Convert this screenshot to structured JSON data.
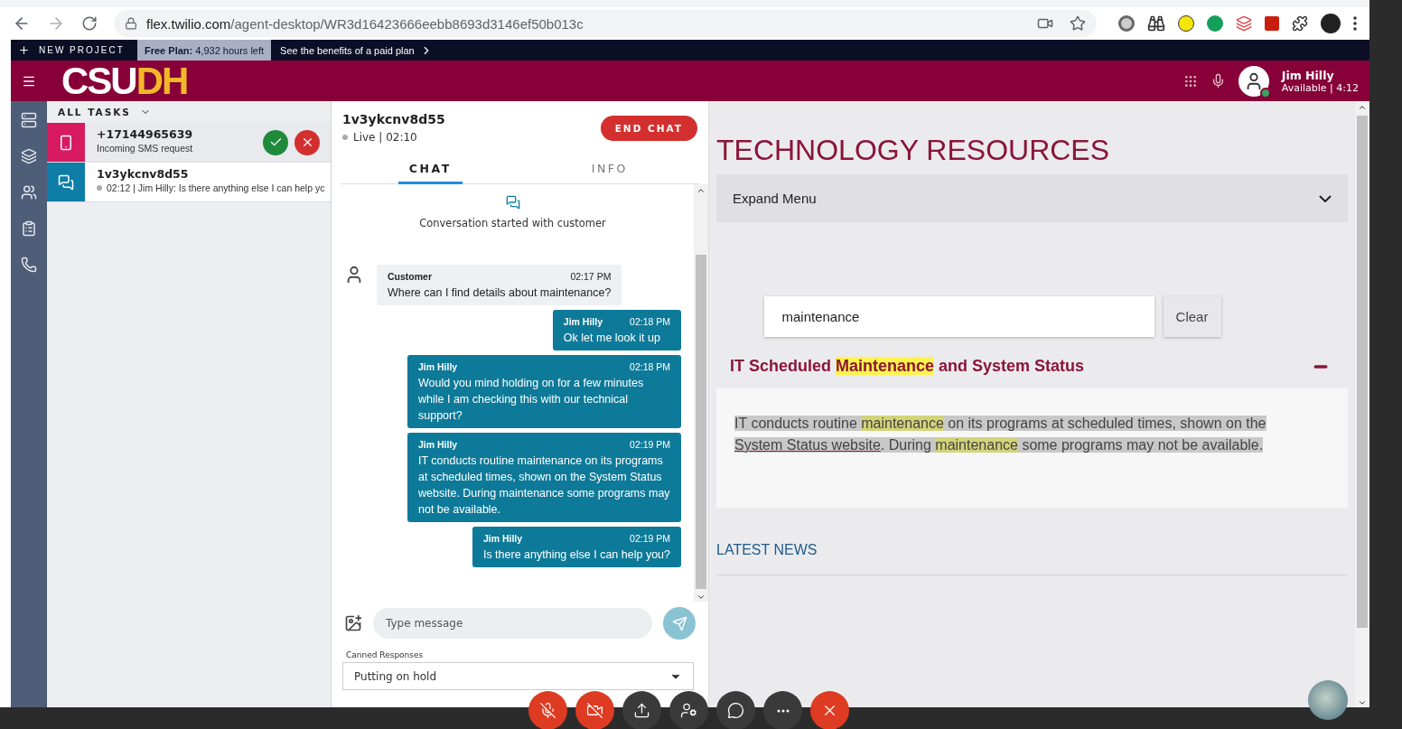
{
  "browser": {
    "url_host": "flex.twilio.com",
    "url_path": "/agent-desktop/WR3d16423666eebb8693d3146ef50b013c"
  },
  "project_bar": {
    "project": "NEW PROJECT",
    "plan_label": "Free Plan:",
    "plan_hours": "4,932 hours left",
    "upgrade": "See the benefits of a paid plan"
  },
  "header": {
    "logo_main": "CSU",
    "logo_accent": "DH",
    "user": {
      "name": "Jim Hilly",
      "status": "Available | 4:12",
      "available": true
    }
  },
  "tasks": {
    "filter": "ALL TASKS",
    "items": [
      {
        "kind": "sms",
        "color": "#d81b60",
        "title": "+17144965639",
        "subtitle": "Incoming SMS request",
        "selected": false,
        "pending": true
      },
      {
        "kind": "chat",
        "color": "#0e7ea8",
        "title": "1v3ykcnv8d55",
        "subtitle": "02:12 | Jim Hilly: Is there anything else I can help yc",
        "selected": true,
        "pending": false
      }
    ]
  },
  "chat": {
    "title": "1v3ykcnv8d55",
    "status": "Live | 02:10",
    "end_button": "END CHAT",
    "tabs": [
      {
        "label": "CHAT",
        "selected": true
      },
      {
        "label": "INFO",
        "selected": false
      }
    ],
    "started": "Conversation started with customer",
    "messages": [
      {
        "kind": "customer",
        "author": "Customer",
        "time": "02:17 PM",
        "text": "Where can I find details about maintenance?"
      },
      {
        "kind": "agent",
        "author": "Jim Hilly",
        "time": "02:18 PM",
        "text": "Ok let me look it up"
      },
      {
        "kind": "agent",
        "author": "Jim Hilly",
        "time": "02:18 PM",
        "text": "Would you mind holding on for a few minutes while I am checking this with our technical support?"
      },
      {
        "kind": "agent",
        "author": "Jim Hilly",
        "time": "02:19 PM",
        "text": "IT conducts routine maintenance on its programs at scheduled times, shown on the System Status website. During maintenance some programs may not be available."
      },
      {
        "kind": "agent",
        "author": "Jim Hilly",
        "time": "02:19 PM",
        "text": "Is there anything else I can help you?"
      }
    ],
    "input": {
      "placeholder": "Type message"
    },
    "canned": {
      "label": "Canned Responses",
      "value": "Putting on hold"
    }
  },
  "resources": {
    "title": "TECHNOLOGY RESOURCES",
    "menu": "Expand Menu",
    "search": {
      "value": "maintenance",
      "clear": "Clear"
    },
    "article": {
      "expanded": true,
      "title": [
        {
          "kind": "plain",
          "text": "IT Scheduled "
        },
        {
          "kind": "highlight",
          "text": "Maintenance"
        },
        {
          "kind": "plain",
          "text": " and System Status"
        }
      ],
      "selected": true,
      "body": [
        {
          "kind": "plain",
          "text": "IT conducts routine "
        },
        {
          "kind": "highlight",
          "text": "maintenance"
        },
        {
          "kind": "plain",
          "text": " on its programs at scheduled times, shown on the "
        },
        {
          "kind": "link",
          "text": "System Status website"
        },
        {
          "kind": "plain",
          "text": ". During "
        },
        {
          "kind": "highlight",
          "text": "maintenance"
        },
        {
          "kind": "plain",
          "text": " some programs may not be available."
        }
      ]
    },
    "news": "LATEST NEWS"
  },
  "call_controls": [
    {
      "kind": "mic",
      "alert": true
    },
    {
      "kind": "camera",
      "alert": true
    },
    {
      "kind": "share",
      "alert": false
    },
    {
      "kind": "participants",
      "alert": false
    },
    {
      "kind": "chat",
      "alert": false
    },
    {
      "kind": "more",
      "alert": false
    },
    {
      "kind": "leave",
      "alert": true
    }
  ]
}
